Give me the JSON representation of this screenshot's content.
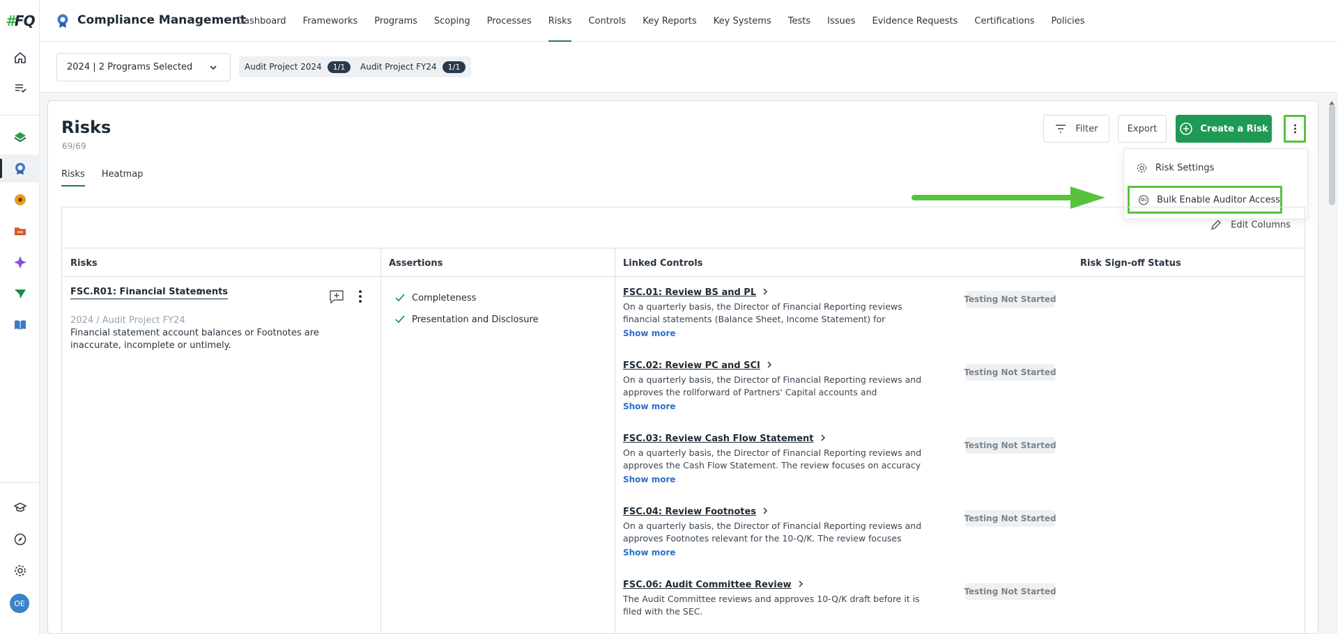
{
  "app": {
    "logo_hash": "#",
    "logo_text": "FQ",
    "title": "Compliance Management"
  },
  "nav": [
    {
      "label": "Dashboard"
    },
    {
      "label": "Frameworks"
    },
    {
      "label": "Programs"
    },
    {
      "label": "Scoping"
    },
    {
      "label": "Processes"
    },
    {
      "label": "Risks",
      "active": true
    },
    {
      "label": "Controls"
    },
    {
      "label": "Key Reports"
    },
    {
      "label": "Key Systems"
    },
    {
      "label": "Tests"
    },
    {
      "label": "Issues"
    },
    {
      "label": "Evidence Requests"
    },
    {
      "label": "Certifications"
    },
    {
      "label": "Policies"
    }
  ],
  "program_bar": {
    "selector_value": "2024 | 2 Programs Selected",
    "chips": [
      {
        "label": "Audit Project 2024",
        "count": "1/1"
      },
      {
        "label": "Audit Project FY24",
        "count": "1/1"
      }
    ]
  },
  "page": {
    "title": "Risks",
    "count": "69/69",
    "tabs": [
      {
        "label": "Risks"
      },
      {
        "label": "Heatmap"
      }
    ]
  },
  "toolbar": {
    "filter_label": "Filter",
    "export_label": "Export",
    "create_label": "Create a Risk"
  },
  "menu": {
    "items": [
      {
        "label": "Risk Settings",
        "icon": "gear-icon"
      },
      {
        "label": "Bulk Enable Auditor Access",
        "icon": "auditor-icon"
      }
    ]
  },
  "table": {
    "edit_columns_label": "Edit Columns",
    "columns": [
      "Risks",
      "Assertions",
      "Linked Controls",
      "Risk Sign-off Status"
    ],
    "risk": {
      "title": "FSC.R01: Financial Statements",
      "path": "2024 / Audit Project FY24",
      "description": "Financial statement account balances or Footnotes are inaccurate, incomplete or untimely."
    },
    "assertions": [
      "Completeness",
      "Presentation and Disclosure"
    ],
    "controls": [
      {
        "title": "FSC.01: Review BS and PL",
        "desc": "On a quarterly basis, the Director of Financial Reporting reviews financial statements (Balance Sheet, Income Statement) for accuracy and…",
        "more": "Show more",
        "status": "Testing Not Started"
      },
      {
        "title": "FSC.02: Review PC and SCI",
        "desc": "On a quarterly basis, the Director of Financial Reporting reviews and approves the rollforward of Partners' Capital accounts and Statement o…",
        "more": "Show more",
        "status": "Testing Not Started"
      },
      {
        "title": "FSC.03: Review Cash Flow Statement",
        "desc": "On a quarterly basis, the Director of Financial Reporting reviews and approves the Cash Flow Statement. The review focuses on accuracy an…",
        "more": "Show more",
        "status": "Testing Not Started"
      },
      {
        "title": "FSC.04: Review Footnotes",
        "desc": "On a quarterly basis, the Director of Financial Reporting reviews and approves Footnotes relevant for the 10-Q/K. The review focuses on…",
        "more": "Show more",
        "status": "Testing Not Started"
      },
      {
        "title": "FSC.06: Audit Committee Review",
        "desc": "The Audit Committee reviews and approves 10-Q/K draft before it is filed with the SEC.",
        "more": "",
        "status": "Testing Not Started"
      }
    ]
  },
  "user": {
    "initials": "OE"
  },
  "colors": {
    "accent": "#1f9a55",
    "highlight": "#58c23c",
    "link": "#2a6fc9"
  }
}
